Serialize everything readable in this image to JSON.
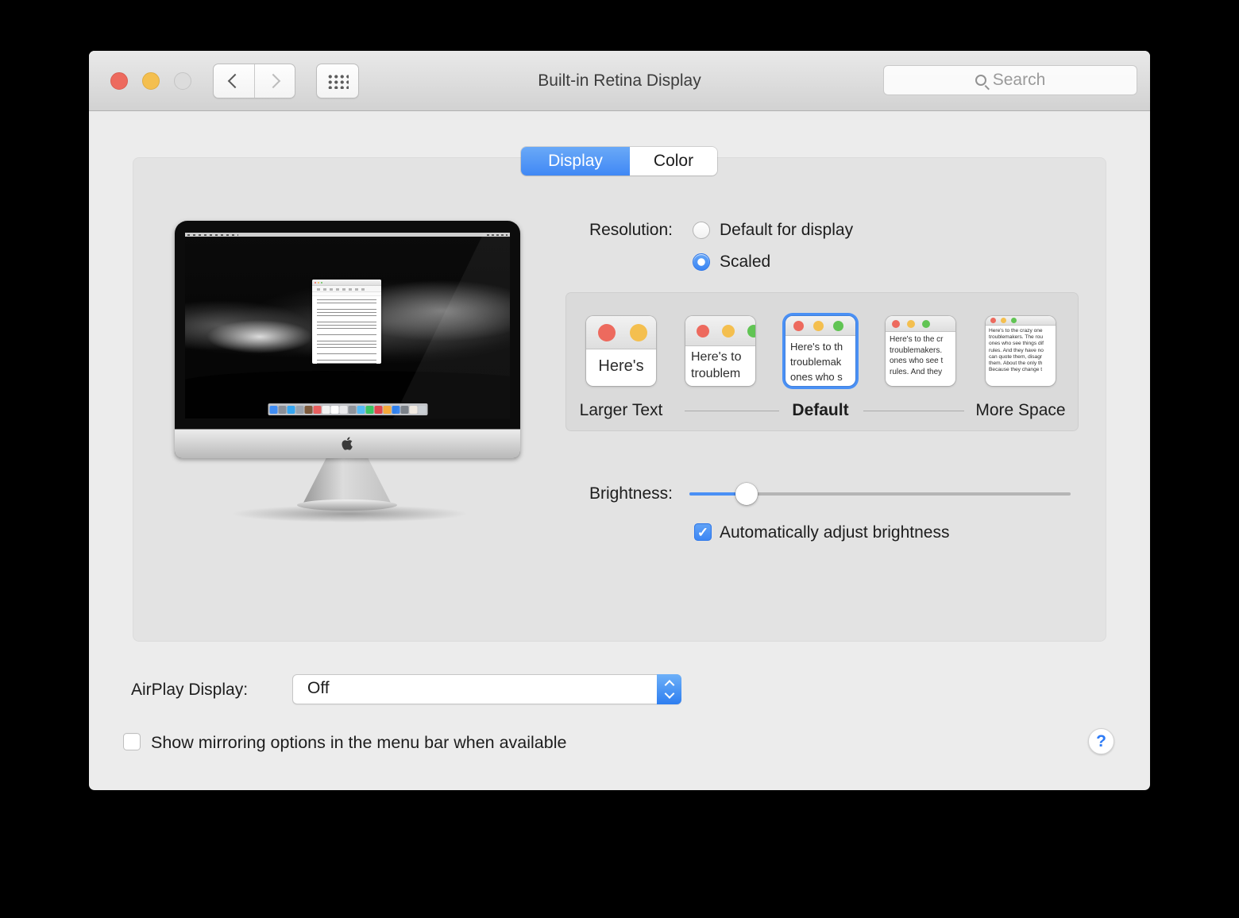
{
  "window": {
    "title": "Built-in Retina Display"
  },
  "toolbar": {
    "search_placeholder": "Search"
  },
  "tabs": [
    {
      "label": "Display",
      "selected": true
    },
    {
      "label": "Color",
      "selected": false
    }
  ],
  "resolution": {
    "label": "Resolution:",
    "options": [
      {
        "label": "Default for display",
        "selected": false
      },
      {
        "label": "Scaled",
        "selected": true
      }
    ]
  },
  "scaled": {
    "thumbnails": [
      {
        "lines": [
          "Here's"
        ],
        "selected": false
      },
      {
        "lines": [
          "Here's to",
          "troublem"
        ],
        "selected": false
      },
      {
        "lines": [
          "Here's to th",
          "troublemak",
          "ones who s"
        ],
        "selected": true
      },
      {
        "lines": [
          "Here's to the cr",
          "troublemakers.",
          "ones who see t",
          "rules. And they"
        ],
        "selected": false
      },
      {
        "lines": [
          "Here's to the crazy one",
          "troublemakers. The rou",
          "ones who see things dif",
          "rules. And they have no",
          "can quote them, disagr",
          "them. About the only th",
          "Because they change t"
        ],
        "selected": false
      }
    ],
    "scale_labels": {
      "left": "Larger Text",
      "center": "Default",
      "right": "More Space"
    }
  },
  "brightness": {
    "label": "Brightness:",
    "value_percent": 15,
    "auto": {
      "label": "Automatically adjust brightness",
      "checked": true,
      "check_glyph": "✓"
    }
  },
  "airplay": {
    "label": "AirPlay Display:",
    "value": "Off"
  },
  "mirroring": {
    "label": "Show mirroring options in the menu bar when available",
    "checked": false
  },
  "help": {
    "label": "?"
  },
  "colors": {
    "accent_blue": "#4a90f5",
    "traffic_red": "#ed6a5e",
    "traffic_yellow": "#f4bf4f",
    "traffic_green": "#61c454"
  },
  "imac_preview": {
    "dock_icon_colors": [
      "#3f8cf3",
      "#8a8f98",
      "#35a5f0",
      "#9aa2ad",
      "#7d5a3c",
      "#e85f5f",
      "#f2f2f2",
      "#ffffff",
      "#e9e9ec",
      "#8f949b",
      "#54b9f5",
      "#39c463",
      "#e0454f",
      "#f5a93b",
      "#2f80ed",
      "#737a82",
      "#f0e9df",
      "#c7ccd1"
    ]
  }
}
